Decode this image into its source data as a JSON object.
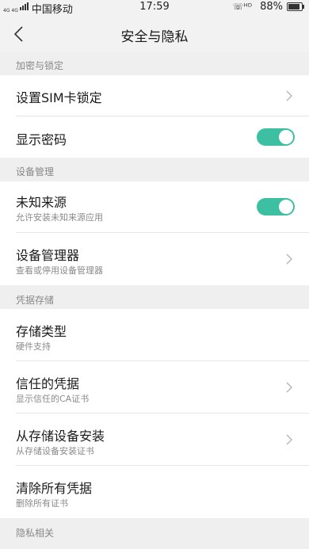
{
  "status_bar": {
    "network": "4G 4G",
    "carrier": "中国移动",
    "time": "17:59",
    "battery": "88%",
    "battery_level": 0.88
  },
  "nav": {
    "title": "安全与隐私"
  },
  "sections": {
    "encryption": {
      "header": "加密与锁定",
      "sim_lock_label": "设置SIM卡锁定",
      "show_password_label": "显示密码",
      "show_password_on": true
    },
    "device_management": {
      "header": "设备管理",
      "unknown_sources_label": "未知来源",
      "unknown_sources_sub": "允许安装未知来源应用",
      "unknown_sources_on": true,
      "device_admin_label": "设备管理器",
      "device_admin_sub": "查看或停用设备管理器"
    },
    "credentials": {
      "header": "凭据存储",
      "storage_type_label": "存储类型",
      "storage_type_sub": "硬件支持",
      "trusted_label": "信任的凭据",
      "trusted_sub": "显示信任的CA证书",
      "install_label": "从存储设备安装",
      "install_sub": "从存储设备安装证书",
      "clear_label": "清除所有凭据",
      "clear_sub": "删除所有证书"
    },
    "privacy": {
      "header": "隐私相关"
    }
  },
  "colors": {
    "toggle_on": "#3dbfa2",
    "section_bg": "#efefef"
  }
}
